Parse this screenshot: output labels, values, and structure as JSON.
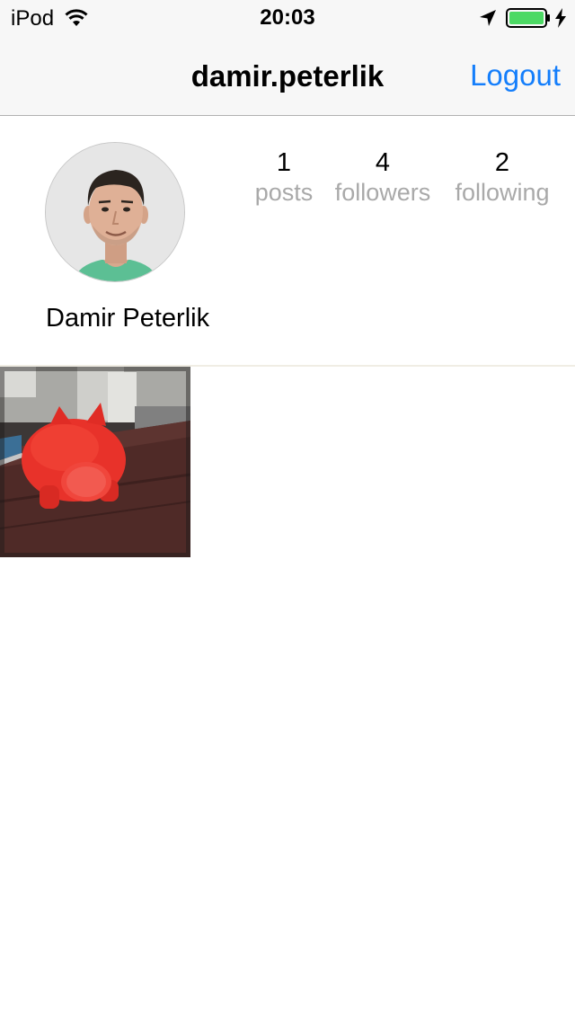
{
  "status_bar": {
    "carrier": "iPod",
    "time": "20:03",
    "battery_color": "#4cd964"
  },
  "nav": {
    "title": "damir.peterlik",
    "logout_label": "Logout",
    "accent_color": "#147efb"
  },
  "profile": {
    "display_name": "Damir Peterlik",
    "stats": [
      {
        "count": "1",
        "label": "posts"
      },
      {
        "count": "4",
        "label": "followers"
      },
      {
        "count": "2",
        "label": "following"
      }
    ]
  },
  "posts": [
    {
      "subject": "red piggy bank on wooden desk"
    }
  ]
}
